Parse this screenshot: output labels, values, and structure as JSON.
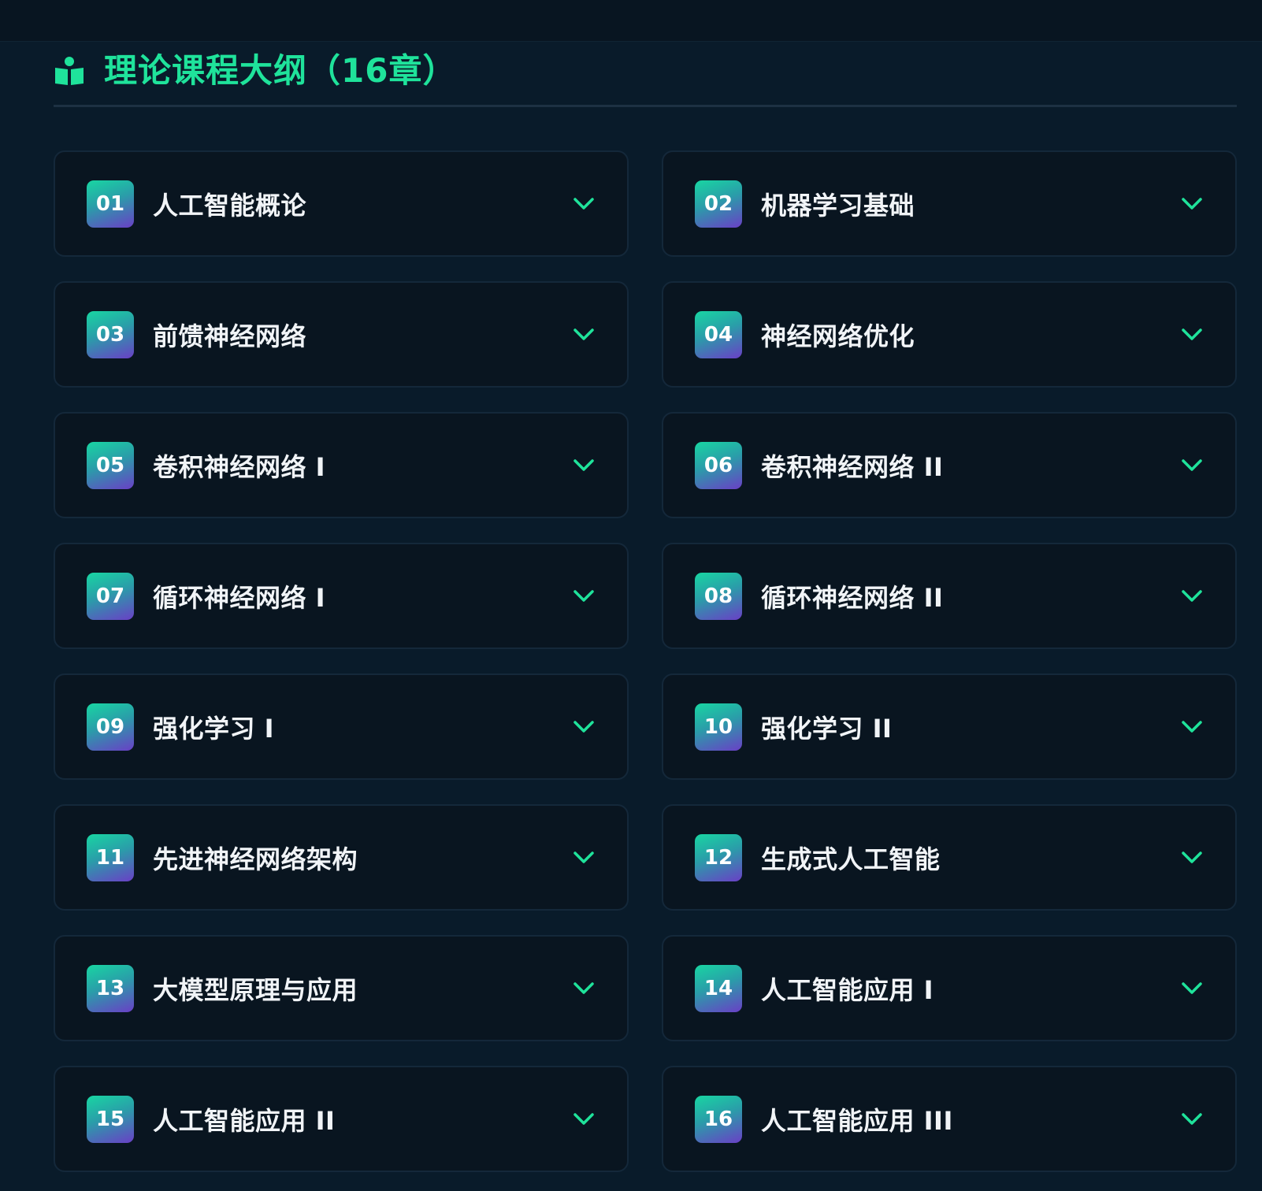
{
  "section": {
    "title": "理论课程大纲（16章）",
    "icon": "book-reader-icon",
    "accent_color": "#1fe39b"
  },
  "chapters": [
    {
      "number": "01",
      "title": "人工智能概论",
      "icon": "chevron-down-icon"
    },
    {
      "number": "02",
      "title": "机器学习基础",
      "icon": "chevron-down-icon"
    },
    {
      "number": "03",
      "title": "前馈神经网络",
      "icon": "chevron-down-icon"
    },
    {
      "number": "04",
      "title": "神经网络优化",
      "icon": "chevron-down-icon"
    },
    {
      "number": "05",
      "title": "卷积神经网络 I",
      "icon": "chevron-down-icon"
    },
    {
      "number": "06",
      "title": "卷积神经网络 II",
      "icon": "chevron-down-icon"
    },
    {
      "number": "07",
      "title": "循环神经网络 I",
      "icon": "chevron-down-icon"
    },
    {
      "number": "08",
      "title": "循环神经网络 II",
      "icon": "chevron-down-icon"
    },
    {
      "number": "09",
      "title": "强化学习 I",
      "icon": "chevron-down-icon"
    },
    {
      "number": "10",
      "title": "强化学习 II",
      "icon": "chevron-down-icon"
    },
    {
      "number": "11",
      "title": "先进神经网络架构",
      "icon": "chevron-down-icon"
    },
    {
      "number": "12",
      "title": "生成式人工智能",
      "icon": "chevron-down-icon"
    },
    {
      "number": "13",
      "title": "大模型原理与应用",
      "icon": "chevron-down-icon"
    },
    {
      "number": "14",
      "title": "人工智能应用 I",
      "icon": "chevron-down-icon"
    },
    {
      "number": "15",
      "title": "人工智能应用 II",
      "icon": "chevron-down-icon"
    },
    {
      "number": "16",
      "title": "人工智能应用 III",
      "icon": "chevron-down-icon"
    }
  ]
}
